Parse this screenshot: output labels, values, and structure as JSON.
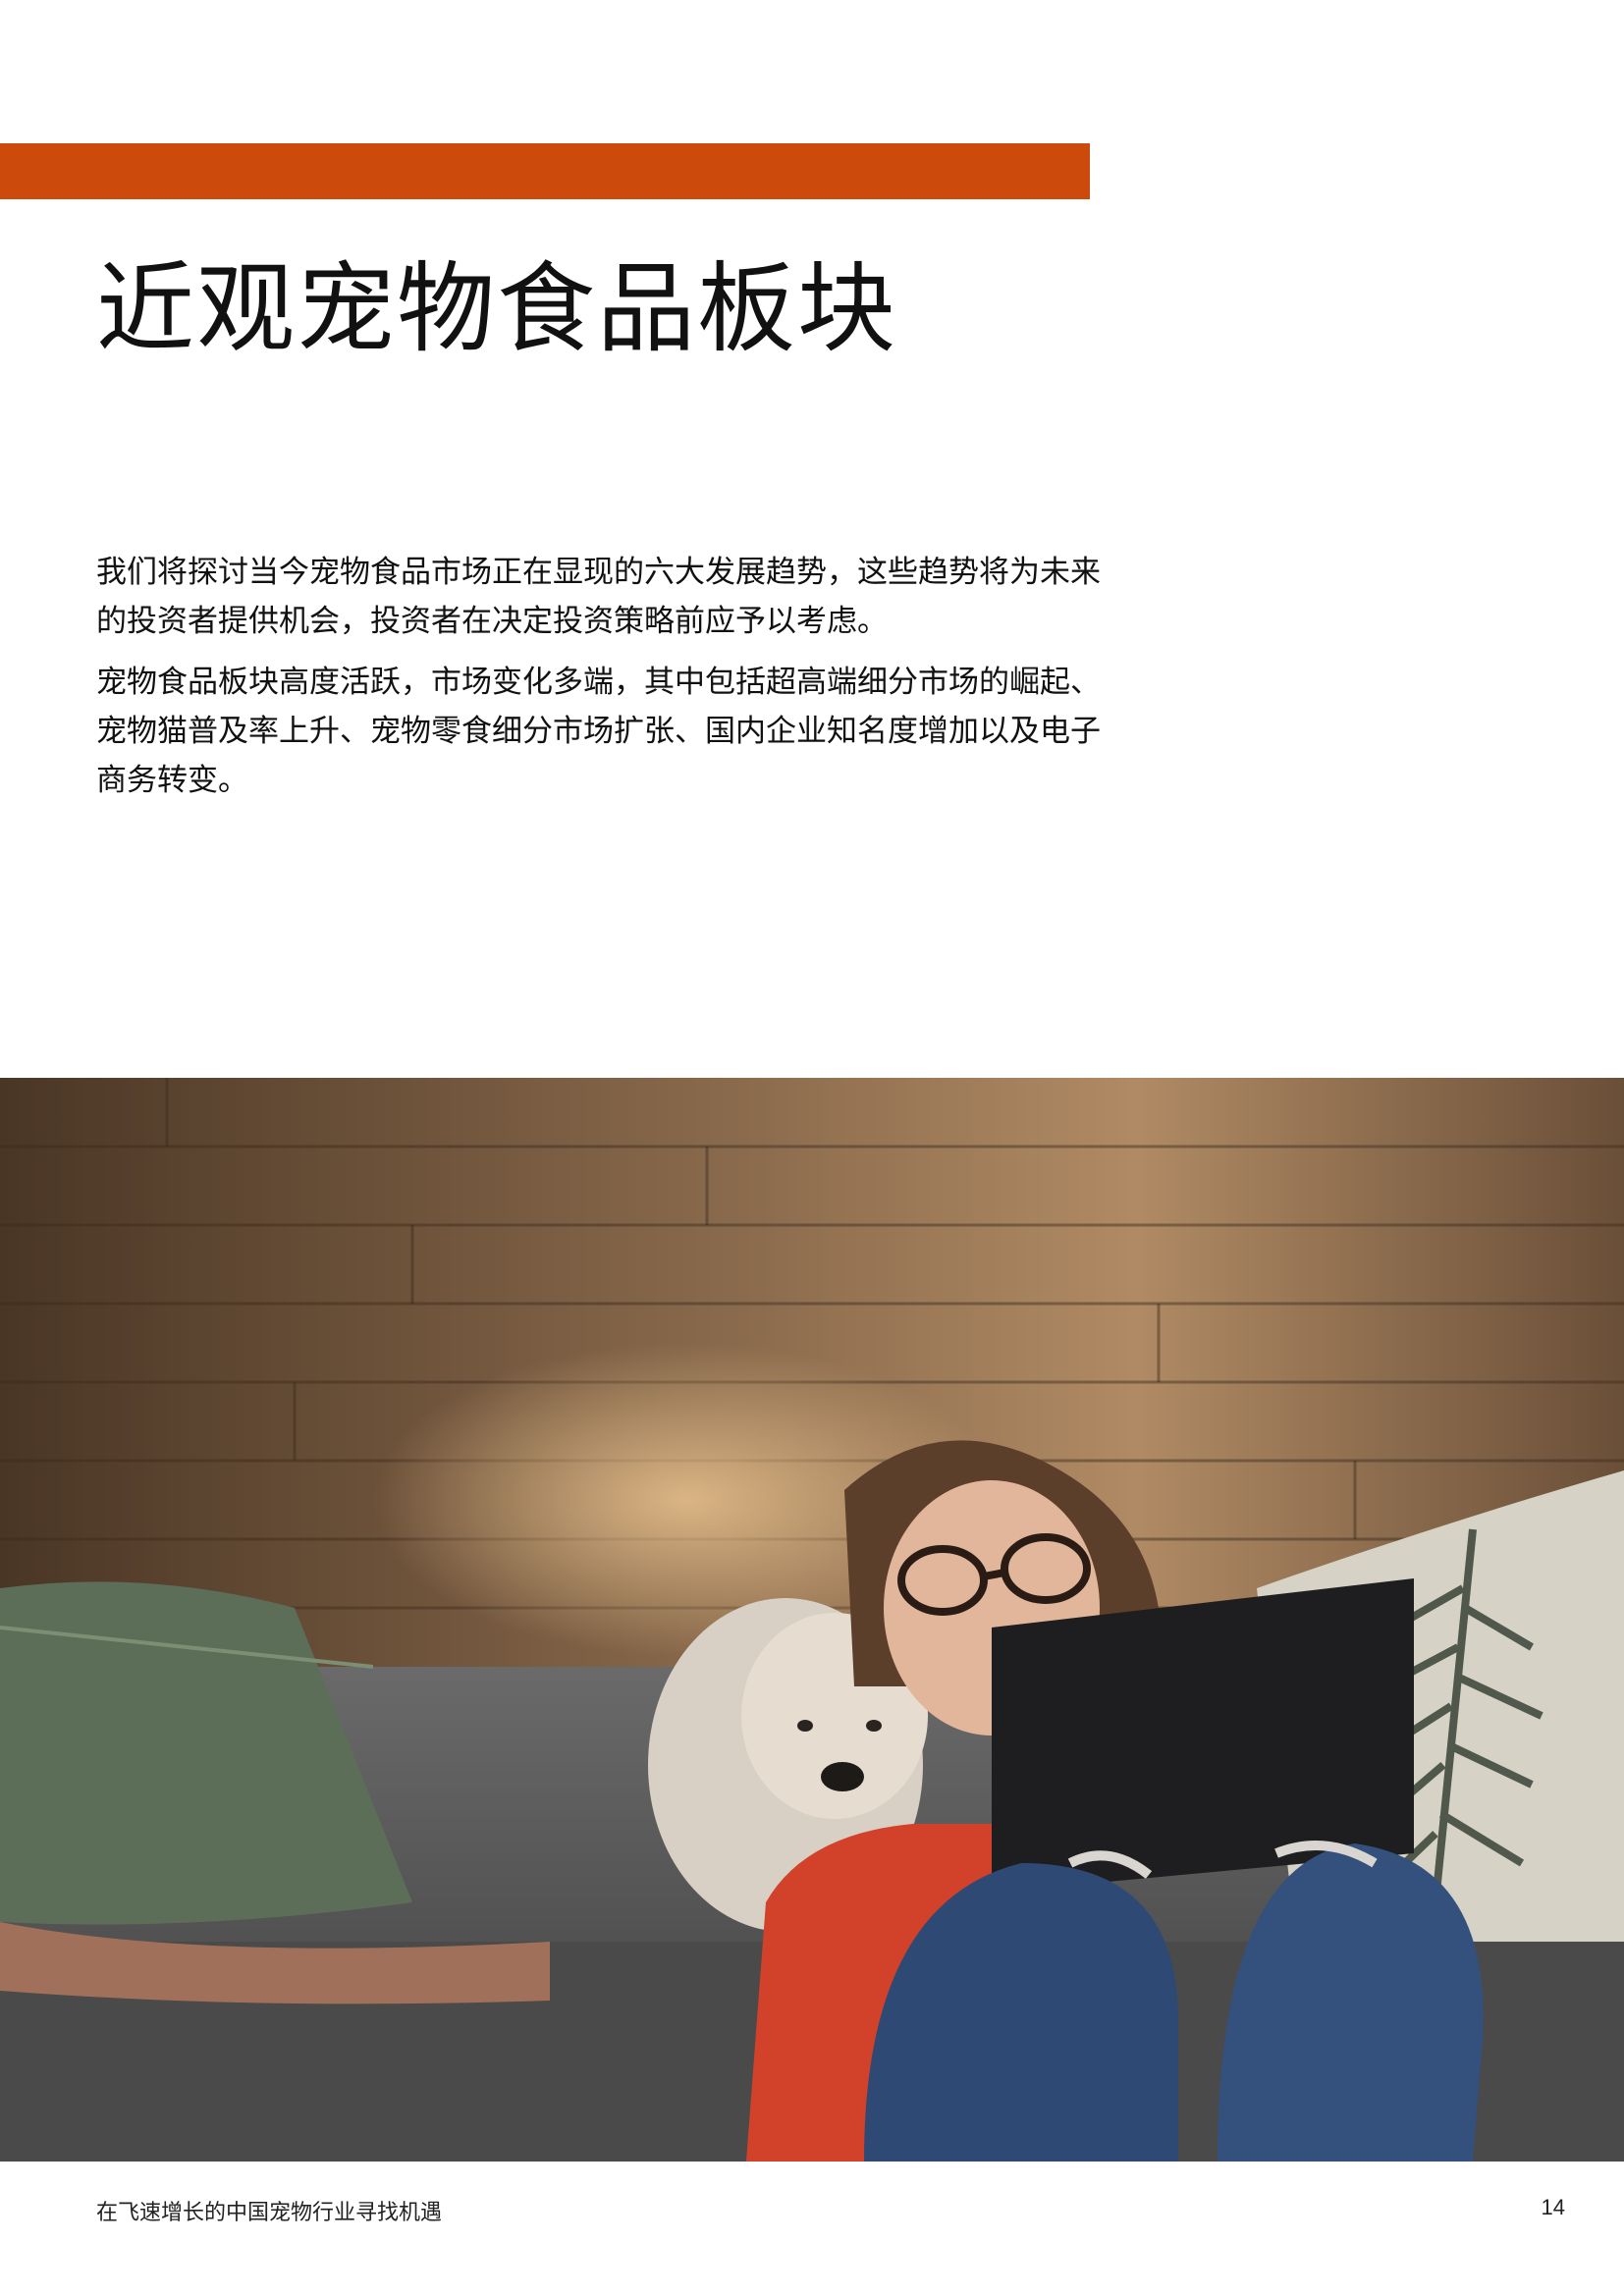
{
  "title": "近观宠物食品板块",
  "paragraphs": [
    "我们将探讨当今宠物食品市场正在显现的六大发展趋势，这些趋势将为未来的投资者提供机会，投资者在决定投资策略前应予以考虑。",
    "宠物食品板块高度活跃，市场变化多端，其中包括超高端细分市场的崛起、宠物猫普及率上升、宠物零食细分市场扩张、国内企业知名度增加以及电子商务转变。"
  ],
  "footer": {
    "publication_title": "在飞速增长的中国宠物行业寻找机遇",
    "page_number": "14"
  },
  "colors": {
    "accent": "#cc4b0c"
  }
}
